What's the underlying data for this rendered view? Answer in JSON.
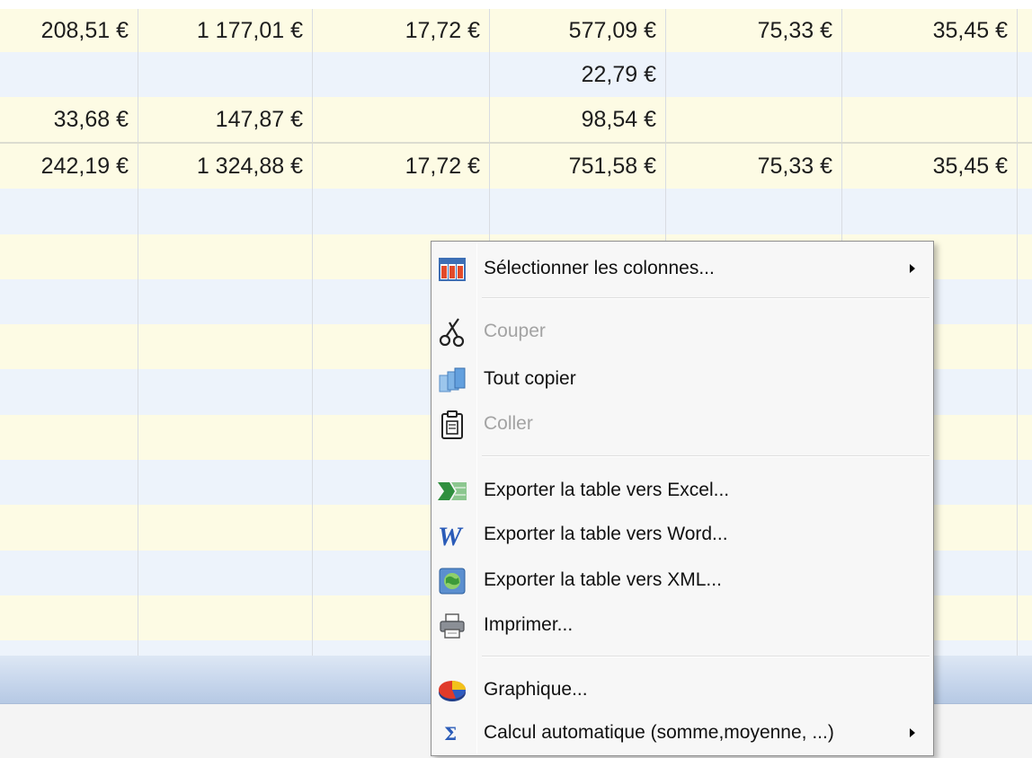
{
  "table": {
    "rows": [
      {
        "style": "yellow",
        "cells": [
          "208,51 €",
          "1 177,01 €",
          "17,72 €",
          "577,09 €",
          "75,33 €",
          "35,45 €"
        ]
      },
      {
        "style": "blue",
        "cells": [
          "",
          "",
          "",
          "22,79 €",
          "",
          ""
        ]
      },
      {
        "style": "yellow",
        "cells": [
          "33,68 €",
          "147,87 €",
          "",
          "98,54 €",
          "",
          ""
        ]
      },
      {
        "style": "yellow total",
        "cells": [
          "242,19 €",
          "1 324,88 €",
          "17,72 €",
          "751,58 €",
          "75,33 €",
          "35,45 €"
        ]
      },
      {
        "style": "blue",
        "cells": [
          "",
          "",
          "",
          "",
          "",
          ""
        ]
      },
      {
        "style": "yellow",
        "cells": [
          "",
          "",
          "",
          "",
          "",
          ""
        ]
      },
      {
        "style": "blue",
        "cells": [
          "",
          "",
          "",
          "",
          "",
          ""
        ]
      },
      {
        "style": "yellow",
        "cells": [
          "",
          "",
          "",
          "",
          "",
          ""
        ]
      },
      {
        "style": "blue",
        "cells": [
          "",
          "",
          "",
          "",
          "",
          ""
        ]
      },
      {
        "style": "yellow",
        "cells": [
          "",
          "",
          "",
          "",
          "",
          ""
        ]
      },
      {
        "style": "blue",
        "cells": [
          "",
          "",
          "",
          "",
          "",
          ""
        ]
      },
      {
        "style": "yellow",
        "cells": [
          "",
          "",
          "",
          "",
          "",
          ""
        ]
      },
      {
        "style": "blue",
        "cells": [
          "",
          "",
          "",
          "",
          "",
          ""
        ]
      },
      {
        "style": "yellow",
        "cells": [
          "",
          "",
          "",
          "",
          "",
          ""
        ]
      }
    ]
  },
  "context_menu": {
    "items": [
      {
        "label": "Sélectionner les colonnes...",
        "icon": "columns-icon",
        "enabled": true,
        "submenu": true
      },
      {
        "label": "Couper",
        "icon": "scissors-icon",
        "enabled": false,
        "submenu": false
      },
      {
        "label": "Tout copier",
        "icon": "copy-icon",
        "enabled": true,
        "submenu": false
      },
      {
        "label": "Coller",
        "icon": "clipboard-icon",
        "enabled": false,
        "submenu": false
      },
      {
        "label": "Exporter la table vers Excel...",
        "icon": "excel-icon",
        "enabled": true,
        "submenu": false
      },
      {
        "label": "Exporter la table vers Word...",
        "icon": "word-icon",
        "enabled": true,
        "submenu": false
      },
      {
        "label": "Exporter la table vers XML...",
        "icon": "xml-globe-icon",
        "enabled": true,
        "submenu": false
      },
      {
        "label": "Imprimer...",
        "icon": "printer-icon",
        "enabled": true,
        "submenu": false
      },
      {
        "label": "Graphique...",
        "icon": "pie-chart-icon",
        "enabled": true,
        "submenu": false
      },
      {
        "label": "Calcul automatique (somme,moyenne, ...)",
        "icon": "sigma-icon",
        "enabled": true,
        "submenu": true
      }
    ]
  },
  "colors": {
    "row_yellow": "#fdfbe4",
    "row_blue": "#edf3fb",
    "disabled_text": "#a3a3a3"
  }
}
